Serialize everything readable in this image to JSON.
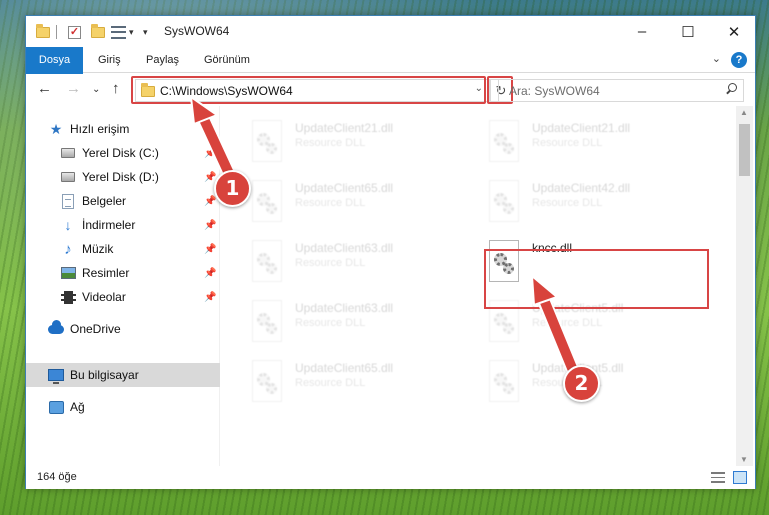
{
  "window": {
    "title": "SysWOW64",
    "controls": {
      "minimize": "–",
      "maximize": "☐",
      "close": "✕"
    },
    "help": "?"
  },
  "ribbon": {
    "tabs": [
      "Dosya",
      "Giriş",
      "Paylaş",
      "Görünüm"
    ]
  },
  "navbar": {
    "address": "C:\\Windows\\SysWOW64",
    "search_placeholder": "Ara: SysWOW64"
  },
  "nav_pane": {
    "items": [
      {
        "label": "Hızlı erişim",
        "icon": "star-icon"
      },
      {
        "label": "Yerel Disk (C:)",
        "icon": "disk-icon",
        "pinned": true
      },
      {
        "label": "Yerel Disk (D:)",
        "icon": "disk-icon",
        "pinned": true
      },
      {
        "label": "Belgeler",
        "icon": "documents-icon",
        "pinned": true
      },
      {
        "label": "İndirmeler",
        "icon": "downloads-icon",
        "pinned": true
      },
      {
        "label": "Müzik",
        "icon": "music-icon",
        "pinned": true
      },
      {
        "label": "Resimler",
        "icon": "pictures-icon",
        "pinned": true
      },
      {
        "label": "Videolar",
        "icon": "videos-icon",
        "pinned": true
      },
      {
        "label": "OneDrive",
        "icon": "onedrive-icon"
      },
      {
        "label": "Bu bilgisayar",
        "icon": "computer-icon",
        "selected": true
      },
      {
        "label": "Ağ",
        "icon": "network-icon"
      }
    ]
  },
  "files": [
    {
      "name": "UpdateClient21.dll",
      "desc": "Resource DLL",
      "ghost": true
    },
    {
      "name": "UpdateClient21.dll",
      "desc": "Resource DLL",
      "ghost": true
    },
    {
      "name": "UpdateClient65.dll",
      "desc": "Resource DLL",
      "ghost": true
    },
    {
      "name": "UpdateClient42.dll",
      "desc": "Resource DLL",
      "ghost": true
    },
    {
      "name": "UpdateClient63.dll",
      "desc": "Resource DLL",
      "ghost": true
    },
    {
      "name": "kncc.dll",
      "desc": "",
      "ghost": false
    },
    {
      "name": "UpdateClient63.dll",
      "desc": "Resource DLL",
      "ghost": true
    },
    {
      "name": "UpdateClient5.dll",
      "desc": "Resource DLL",
      "ghost": true
    },
    {
      "name": "UpdateClient65.dll",
      "desc": "Resource DLL",
      "ghost": true
    },
    {
      "name": "UpdateClient5.dll",
      "desc": "Resource DLL",
      "ghost": true
    }
  ],
  "status": {
    "count": "164 öğe"
  },
  "annotations": {
    "step1": "1",
    "step2": "2"
  },
  "colors": {
    "accent": "#1979ca",
    "highlight": "#d84545"
  }
}
